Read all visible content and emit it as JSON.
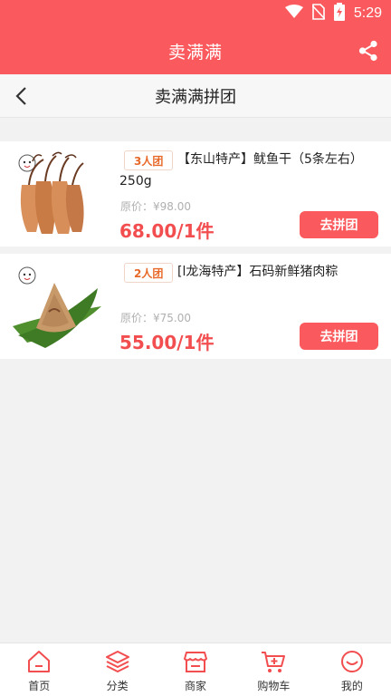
{
  "status_bar": {
    "time": "5:29",
    "icons": [
      "wifi-icon",
      "no-sim-icon",
      "battery-charging-icon"
    ]
  },
  "app_header": {
    "title": "卖满满",
    "share_icon": "share-icon"
  },
  "sub_header": {
    "title": "卖满满拼团",
    "back_icon": "chevron-left-icon"
  },
  "products": [
    {
      "badge": "3人团",
      "title": "【东山特产】鱿鱼干（5条左右）250g",
      "original_price": "原价：¥98.00",
      "price": "68.00/1件",
      "button": "去拼团",
      "image": "dried-squid-image"
    },
    {
      "badge": "2人团",
      "title": "[l龙海特产】石码新鲜猪肉粽",
      "original_price": "原价：¥75.00",
      "price": "55.00/1件",
      "button": "去拼团",
      "image": "zongzi-image"
    }
  ],
  "tab_bar": {
    "items": [
      {
        "label": "首页",
        "icon": "home-icon"
      },
      {
        "label": "分类",
        "icon": "layers-icon"
      },
      {
        "label": "商家",
        "icon": "store-icon"
      },
      {
        "label": "购物车",
        "icon": "cart-icon"
      },
      {
        "label": "我的",
        "icon": "profile-icon"
      }
    ]
  },
  "colors": {
    "brand_red": "#fa5a5d",
    "price_red": "#f24d4f",
    "badge_orange": "#e86a2a",
    "background": "#f2f2f2"
  }
}
